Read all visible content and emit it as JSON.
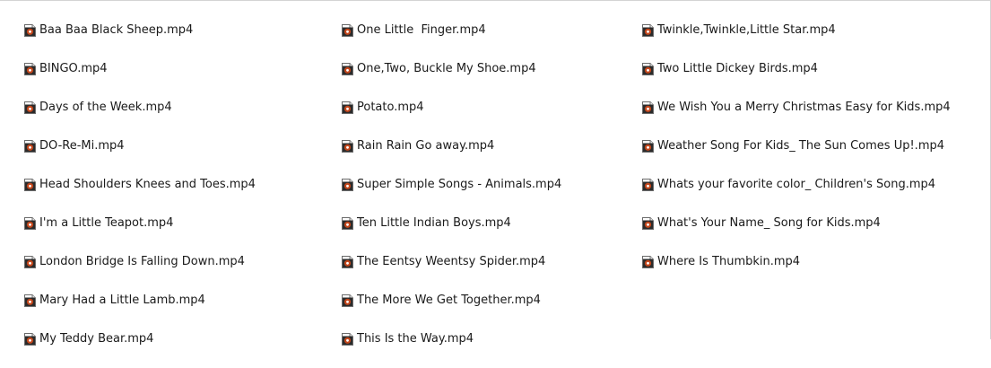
{
  "icon": "video-file-icon",
  "colors": {
    "icon_accent": "#c2461b",
    "icon_outline": "#6b6b6b",
    "text": "#1a1a1a",
    "border": "#d4d4d4"
  },
  "files": {
    "column_1": [
      "Baa Baa Black Sheep.mp4",
      "BINGO.mp4",
      "Days of the Week.mp4",
      "DO-Re-Mi.mp4",
      "Head Shoulders Knees and Toes.mp4",
      "I'm a Little Teapot.mp4",
      "London Bridge Is Falling Down.mp4",
      "Mary Had a Little Lamb.mp4",
      "My Teddy Bear.mp4"
    ],
    "column_2": [
      "One Little  Finger.mp4",
      "One,Two, Buckle My Shoe.mp4",
      "Potato.mp4",
      "Rain Rain Go away.mp4",
      "Super Simple Songs - Animals.mp4",
      "Ten Little Indian Boys.mp4",
      "The Eentsy Weentsy Spider.mp4",
      "The More We Get Together.mp4",
      "This Is the Way.mp4"
    ],
    "column_3": [
      "Twinkle,Twinkle,Little Star.mp4",
      "Two Little Dickey Birds.mp4",
      "We Wish You a Merry Christmas Easy for Kids.mp4",
      "Weather Song For Kids_ The Sun Comes Up!.mp4",
      "Whats your favorite color_ Children's Song.mp4",
      "What's Your Name_ Song for Kids.mp4",
      "Where Is Thumbkin.mp4"
    ]
  }
}
